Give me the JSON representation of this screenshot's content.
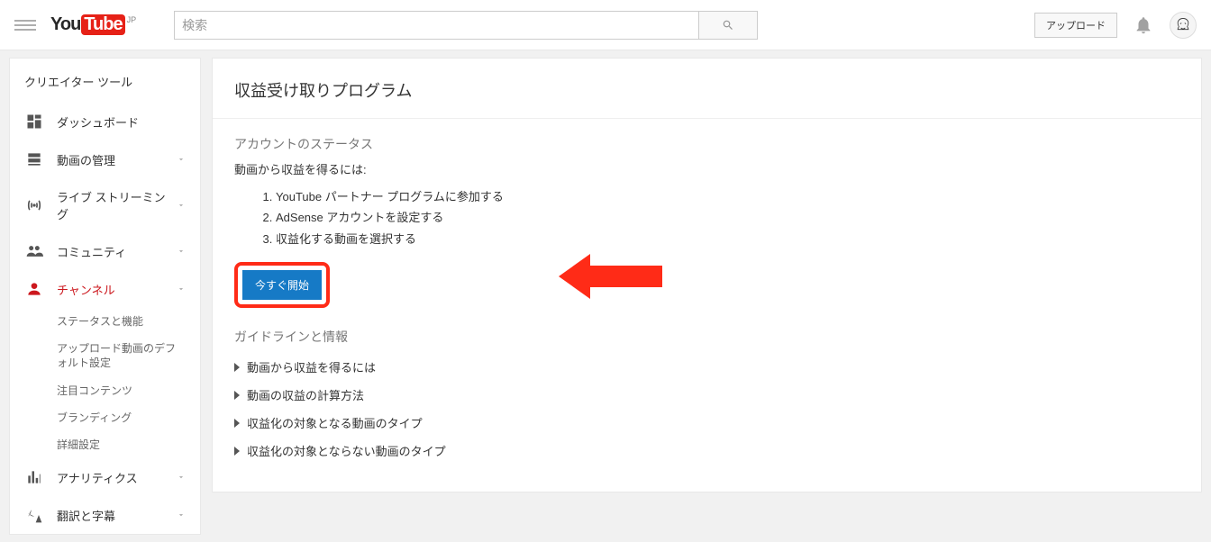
{
  "header": {
    "logo_you": "You",
    "logo_tube": "Tube",
    "region": "JP",
    "search_placeholder": "検索",
    "upload_label": "アップロード"
  },
  "sidebar": {
    "title": "クリエイター ツール",
    "items": [
      {
        "label": "ダッシュボード",
        "icon": "dashboard",
        "expandable": false
      },
      {
        "label": "動画の管理",
        "icon": "video-manager",
        "expandable": true
      },
      {
        "label": "ライブ ストリーミング",
        "icon": "live",
        "expandable": true
      },
      {
        "label": "コミュニティ",
        "icon": "community",
        "expandable": true
      },
      {
        "label": "チャンネル",
        "icon": "channel",
        "expandable": true,
        "active": true,
        "children": [
          "ステータスと機能",
          "アップロード動画のデフォルト設定",
          "注目コンテンツ",
          "ブランディング",
          "詳細設定"
        ]
      },
      {
        "label": "アナリティクス",
        "icon": "analytics",
        "expandable": true
      },
      {
        "label": "翻訳と字幕",
        "icon": "translate",
        "expandable": true
      }
    ]
  },
  "main": {
    "title": "収益受け取りプログラム",
    "status_heading": "アカウントのステータス",
    "intro": "動画から収益を得るには:",
    "steps": [
      "YouTube パートナー プログラムに参加する",
      "AdSense アカウントを設定する",
      "収益化する動画を選択する"
    ],
    "cta_label": "今すぐ開始",
    "guidelines_heading": "ガイドラインと情報",
    "guidelines": [
      "動画から収益を得るには",
      "動画の収益の計算方法",
      "収益化の対象となる動画のタイプ",
      "収益化の対象とならない動画のタイプ"
    ]
  }
}
